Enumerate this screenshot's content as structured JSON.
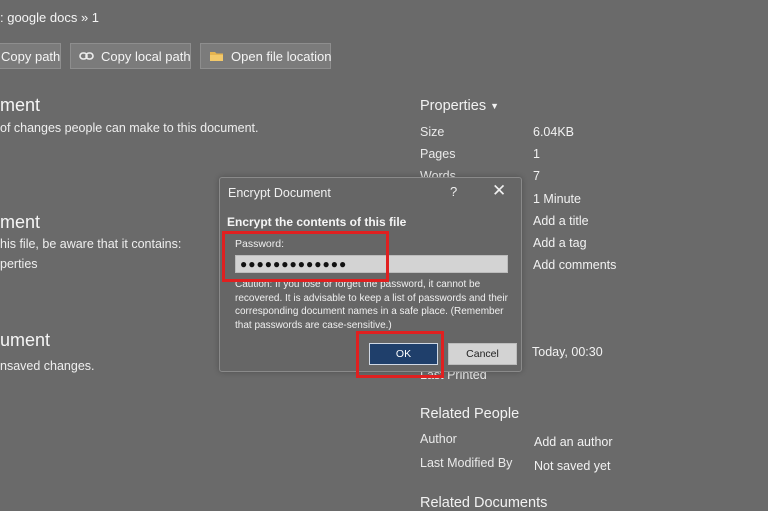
{
  "breadcrumb": ": google docs » 1",
  "toolbar": {
    "copy_path": "Copy path",
    "copy_local_path": "Copy local path",
    "open_file_location": "Open file location"
  },
  "left": {
    "section1_title": "ment",
    "section1_text": "of changes people can make to this document.",
    "section2_title": "ment",
    "section2_line1": "his file, be aware that it contains:",
    "section2_line2": "perties",
    "section3_title": "ument",
    "section3_text": "nsaved changes."
  },
  "properties": {
    "header": "Properties",
    "rows": [
      {
        "label": "Size",
        "value": "6.04KB"
      },
      {
        "label": "Pages",
        "value": "1"
      },
      {
        "label": "Words",
        "value": "7"
      },
      {
        "label": "",
        "value": "1 Minute"
      },
      {
        "label": "",
        "value": "Add a title"
      },
      {
        "label": "",
        "value": "Add a tag"
      },
      {
        "label": "",
        "value": "Add comments"
      }
    ],
    "date_value": "Today, 00:30",
    "last_printed": "Last Printed"
  },
  "related_people": {
    "header": "Related People",
    "author_label": "Author",
    "author_value": "Add an author",
    "modified_label": "Last Modified By",
    "modified_value": "Not saved yet"
  },
  "related_documents": {
    "header": "Related Documents"
  },
  "dialog": {
    "title": "Encrypt Document",
    "help": "?",
    "close": "✕",
    "heading": "Encrypt the contents of this file",
    "password_label": "Password:",
    "password_value": "●●●●●●●●●●●●●",
    "caution": "Caution: If you lose or forget the password, it cannot be recovered. It is advisable to keep a list of passwords and their corresponding document names in a safe place. (Remember that passwords are case-sensitive.)",
    "ok": "OK",
    "cancel": "Cancel"
  },
  "colors": {
    "background": "#6a6a6a",
    "ok_button": "#1f3f6b",
    "highlight": "#e02020"
  }
}
